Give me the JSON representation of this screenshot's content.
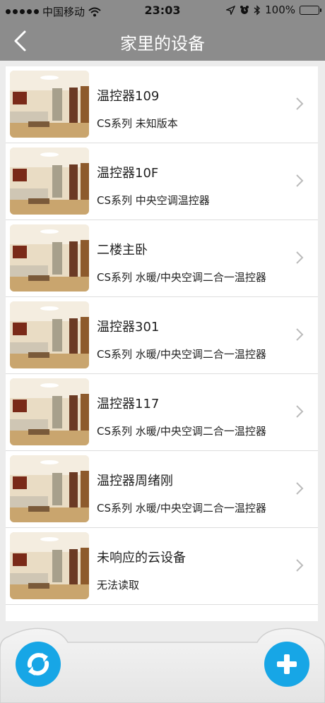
{
  "status_bar": {
    "carrier": "中国移动",
    "time": "23:03",
    "battery": "100%"
  },
  "navbar": {
    "title": "家里的设备"
  },
  "devices": [
    {
      "name": "温控器109",
      "subtitle": "CS系列 未知版本"
    },
    {
      "name": "温控器10F",
      "subtitle": "CS系列 中央空调温控器"
    },
    {
      "name": "二楼主卧",
      "subtitle": "CS系列 水暖/中央空调二合一温控器"
    },
    {
      "name": "温控器301",
      "subtitle": "CS系列 水暖/中央空调二合一温控器"
    },
    {
      "name": "温控器117",
      "subtitle": "CS系列 水暖/中央空调二合一温控器"
    },
    {
      "name": "温控器周绪刚",
      "subtitle": "CS系列 水暖/中央空调二合一温控器"
    },
    {
      "name": "未响应的云设备",
      "subtitle": "无法读取"
    }
  ],
  "icons": {
    "back": "chevron-left-icon",
    "row_arrow": "chevron-right-icon",
    "refresh": "refresh-icon",
    "add": "plus-icon"
  },
  "colors": {
    "header": "#8c8c8c",
    "accent": "#17a6e6",
    "battery": "#2ecc1f"
  }
}
